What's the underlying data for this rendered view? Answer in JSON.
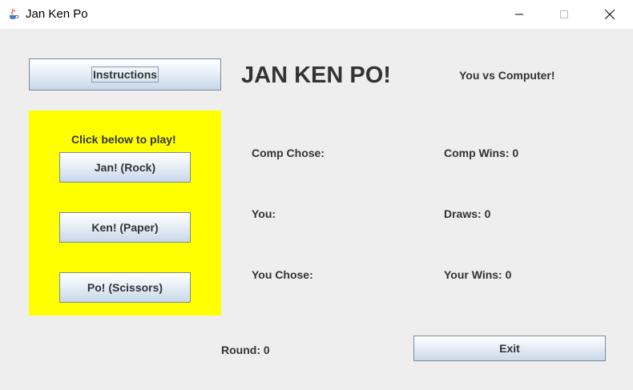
{
  "window": {
    "title": "Jan Ken Po",
    "minimize_glyph": "—",
    "maximize_glyph": "☐",
    "close_glyph": "✕"
  },
  "header": {
    "instructions_label": "Instructions",
    "game_title": "JAN KEN PO!",
    "matchup": "You vs Computer!"
  },
  "play_panel": {
    "background": "#ffff00",
    "prompt": "Click below to play!",
    "rock_label": "Jan! (Rock)",
    "paper_label": "Ken! (Paper)",
    "scissors_label": "Po! (Scissors)"
  },
  "status": {
    "comp_chose": "Comp Chose:",
    "you": "You:",
    "you_chose": "You Chose:",
    "comp_wins": "Comp Wins: 0",
    "draws": "Draws: 0",
    "your_wins": "Your Wins: 0"
  },
  "footer": {
    "round": "Round: 0",
    "exit_label": "Exit"
  }
}
